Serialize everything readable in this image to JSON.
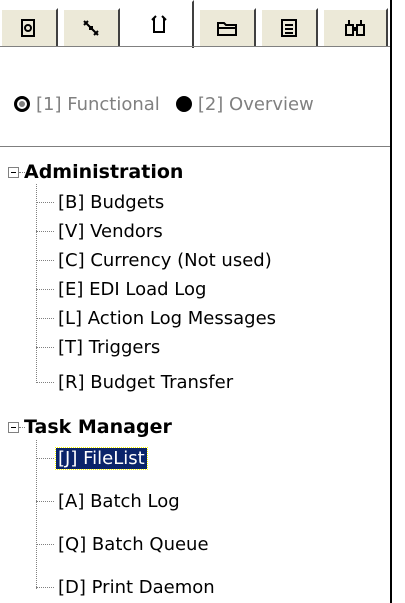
{
  "tabs": [
    {
      "icon": "query-icon",
      "active": false
    },
    {
      "icon": "tools-icon",
      "active": false
    },
    {
      "icon": "task-icon",
      "active": true
    },
    {
      "icon": "folder-icon",
      "active": false
    },
    {
      "icon": "list-icon",
      "active": false
    },
    {
      "icon": "binoculars-icon",
      "active": false
    }
  ],
  "view_options": {
    "functional": "[1] Functional",
    "overview": "[2] Overview",
    "selected": "functional"
  },
  "tree": {
    "administration": {
      "label": "Administration",
      "items": [
        "[B] Budgets",
        "[V] Vendors",
        "[C] Currency (Not used)",
        "[E] EDI Load Log",
        "[L] Action Log Messages",
        "[T] Triggers",
        "[R] Budget Transfer"
      ]
    },
    "task_manager": {
      "label": "Task Manager",
      "items": [
        "[J] FileList",
        "[A] Batch Log",
        "[Q] Batch Queue",
        "[D] Print Daemon"
      ],
      "selected_item": "[J] FileList"
    }
  }
}
